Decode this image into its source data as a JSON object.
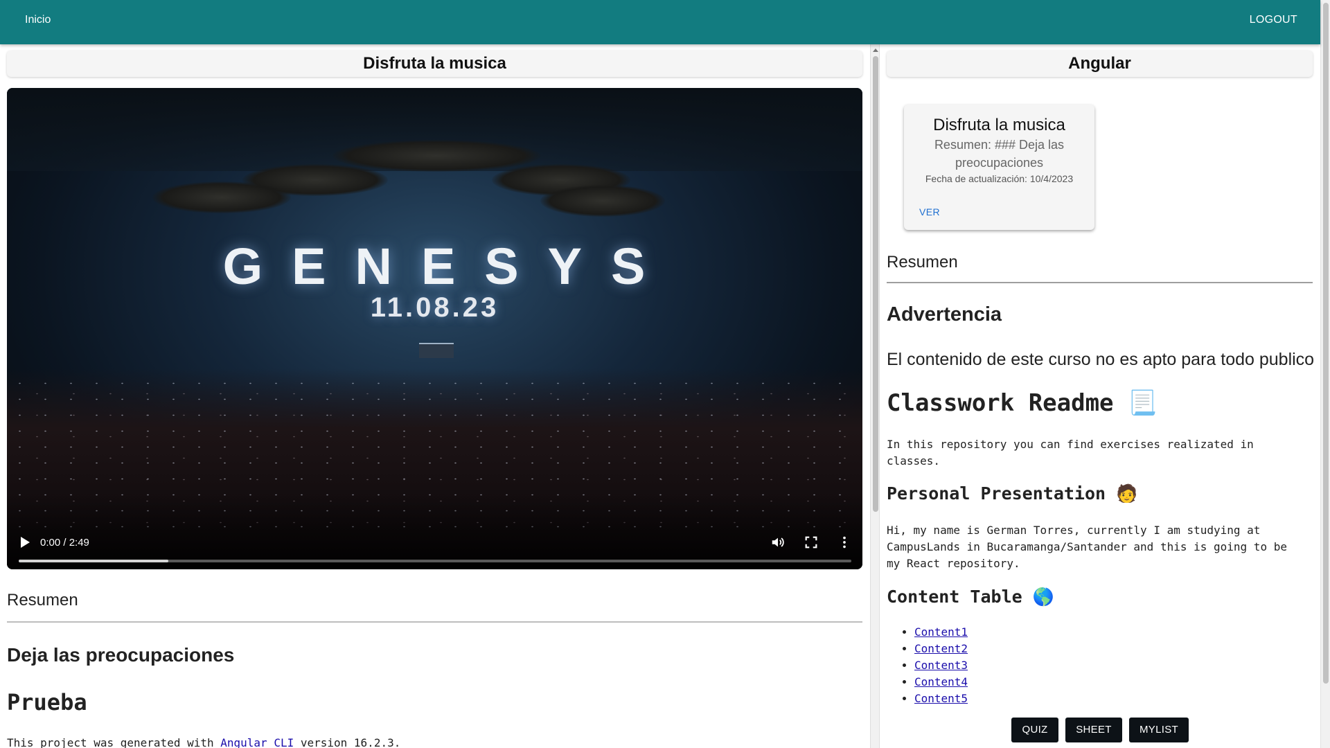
{
  "topbar": {
    "home_label": "Inicio",
    "logout_label": "LOGOUT",
    "color": "#127c80"
  },
  "left": {
    "header": "Disfruta la musica",
    "video": {
      "overlay_title": "GENESYS",
      "overlay_date": "11.08.23",
      "time": "0:00 / 2:49",
      "buffered_fraction": 0.18
    },
    "section_label": "Resumen",
    "heading": "Deja las preocupaciones",
    "mono_heading": "Prueba",
    "line_before": "This project was generated with ",
    "line_link": "Angular CLI",
    "line_after": " version 16.2.3."
  },
  "right": {
    "header": "Angular",
    "card": {
      "title": "Disfruta la musica",
      "summary": "Resumen: ### Deja las preocupaciones",
      "date": "Fecha de actualización: 10/4/2023",
      "button": "VER"
    },
    "section_label": "Resumen",
    "warning_heading": "Advertencia",
    "warning_text": "El contenido de este curso no es apto para todo publico",
    "readme_heading": "Classwork Readme",
    "readme_emoji": "📃",
    "readme_text": "In this repository you can find exercises realizated in classes.",
    "presentation_heading": "Personal Presentation",
    "presentation_emoji": "🧑",
    "presentation_text": "Hi, my name is German Torres, currently I am studying at CampusLands in Bucaramanga/Santander and this is going to be my React repository.",
    "table_heading": "Content Table",
    "table_emoji": "🌎",
    "contents": [
      "Content1",
      "Content2",
      "Content3",
      "Content4",
      "Content5"
    ],
    "buttons": {
      "quiz": "QUIZ",
      "sheet": "SHEET",
      "mylist": "MYLIST"
    }
  }
}
